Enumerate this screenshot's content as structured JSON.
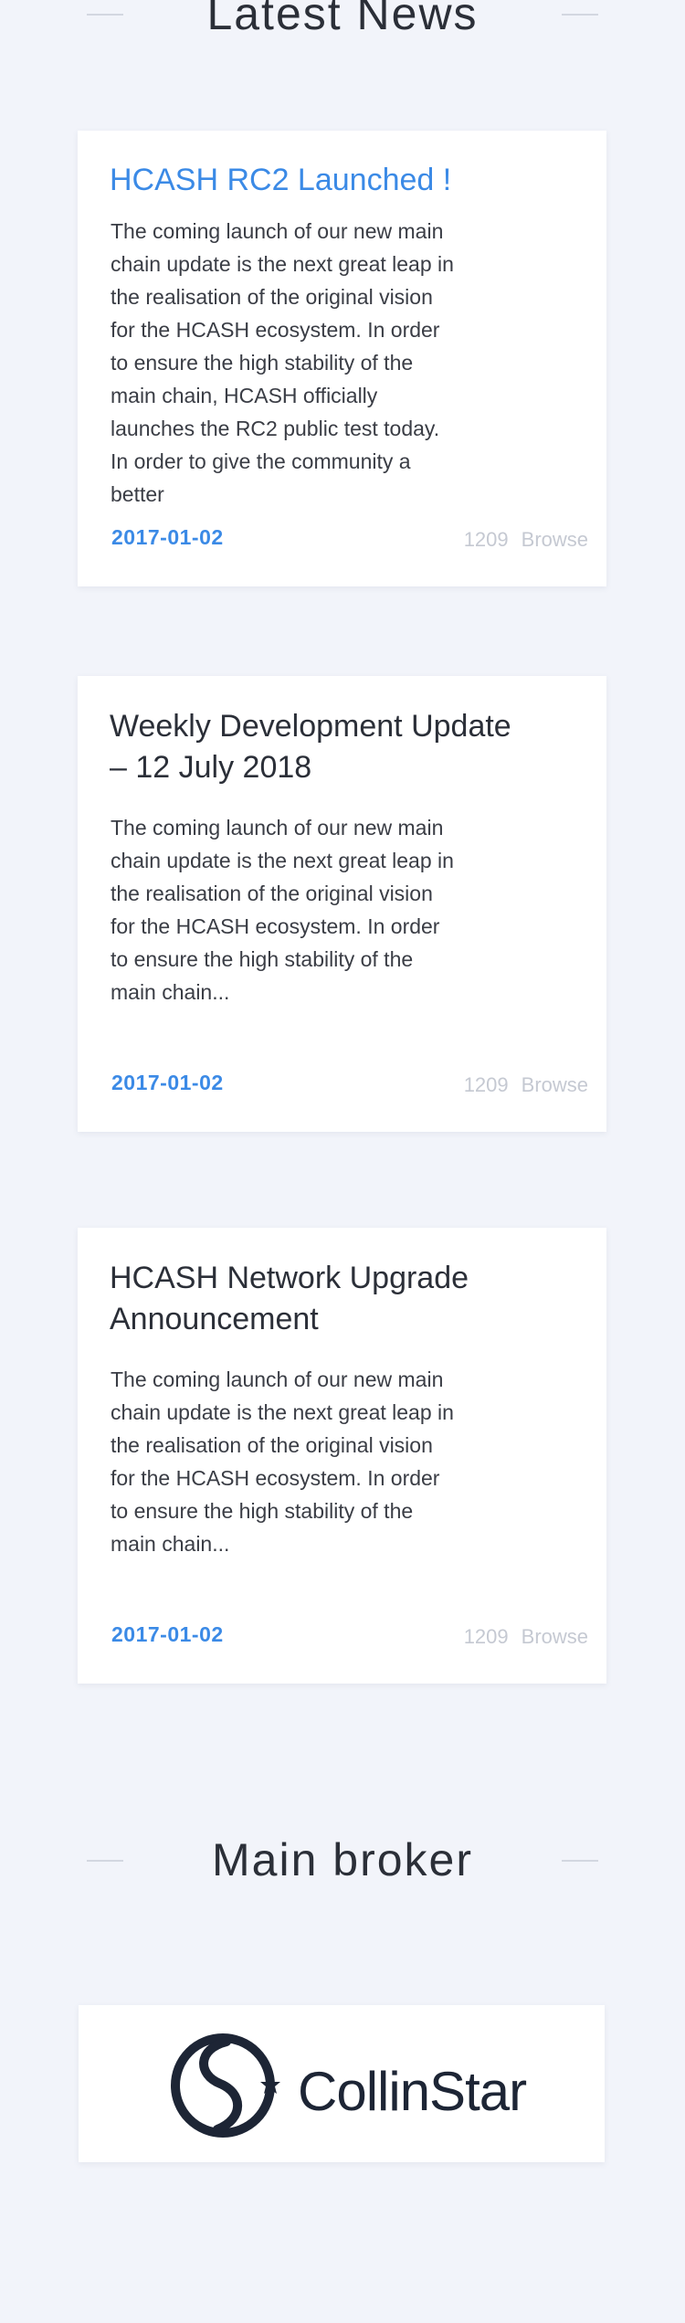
{
  "latest_news": {
    "heading": "Latest News",
    "articles": [
      {
        "title": "HCASH RC2 Launched !",
        "summary": "The coming launch of our new main chain update is the next great leap in the realisation of the original vision for the HCASH ecosystem. In order to ensure the high stability of the main chain, HCASH officially launches the RC2 public test today. In order to give the community a better",
        "date": "2017-01-02",
        "views_count": "1209",
        "views_label": "Browse",
        "title_color": "#3b8ae6"
      },
      {
        "title": "Weekly Development Update – 12 July 2018",
        "summary": "The coming launch of our new main chain update is the next great leap in the realisation of the original vision for the HCASH ecosystem. In order to ensure the high stability of the main chain...",
        "date": "2017-01-02",
        "views_count": "1209",
        "views_label": "Browse"
      },
      {
        "title": "HCASH Network Upgrade Announcement",
        "summary": "The coming launch of our new main chain update is the next great leap in the realisation of the original vision for the HCASH ecosystem. In order to ensure the high stability of the main chain...",
        "date": "2017-01-02",
        "views_count": "1209",
        "views_label": "Browse"
      }
    ]
  },
  "main_broker": {
    "heading": "Main broker",
    "broker_name": "CollinStar",
    "logo_icon": "collinstar-logo-icon"
  },
  "colors": {
    "accent": "#3b8ae6",
    "background": "#f2f4fa",
    "heading_text": "#2b2f38",
    "muted_text": "#c5c9d2"
  }
}
